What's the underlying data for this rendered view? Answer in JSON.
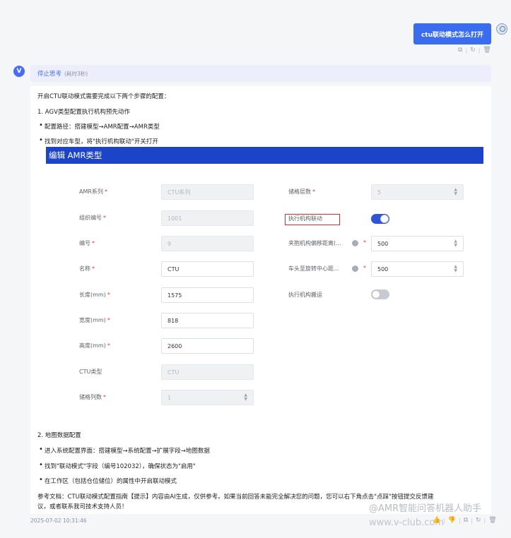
{
  "user_message": {
    "text": "ctu联动模式怎么打开"
  },
  "user_actions": {
    "copy": "⧉",
    "refresh": "↻",
    "delete": "🗑"
  },
  "bot": {
    "avatar_letter": "V"
  },
  "thinking": {
    "label": "停止思考",
    "time": "(耗时3秒)"
  },
  "answer": {
    "intro": "开启CTU联动模式需要完成以下两个步骤的配置：",
    "step1_title": "1. AGV类型配置执行机构预先动作",
    "step1_bullets": [
      "配置路径：搭建模型→AMR配置→AMR类型",
      "找到对应车型，将\"执行机构联动\"开关打开"
    ],
    "step2_title": "2. 地图数据配置",
    "step2_bullets": [
      "进入系统配置界面：搭建模型→系统配置→扩展字段→地图数据",
      "找到\"联动模式\"字段（编号102032），确保状态为\"启用\"",
      "在工作区（包括仓位储位）的属性中开启联动模式"
    ],
    "reference_line1": "参考文档：CTU联动模式配置指南【提示】内容由AI生成，仅供参考。如果当前回答未能完全解决您的问题，您可以右下角点击\"点踩\"按钮提交反馈建",
    "reference_line2": "议，或者联系我司技术支持人员！"
  },
  "form": {
    "title": "编辑 AMR类型",
    "required_mark": "*",
    "left_fields": [
      {
        "label": "AMR系列",
        "required": true,
        "value": "CTU系列",
        "disabled": true
      },
      {
        "label": "组织编号",
        "required": true,
        "value": "1001",
        "disabled": true
      },
      {
        "label": "编号",
        "required": true,
        "value": "9",
        "disabled": true
      },
      {
        "label": "名称",
        "required": true,
        "value": "CTU",
        "disabled": false
      },
      {
        "label": "长度(mm)",
        "required": true,
        "value": "1575",
        "disabled": false
      },
      {
        "label": "宽度(mm)",
        "required": true,
        "value": "818",
        "disabled": false
      },
      {
        "label": "高度(mm)",
        "required": true,
        "value": "2600",
        "disabled": false
      },
      {
        "label": "CTU类型",
        "required": false,
        "value": "CTU",
        "disabled": true
      },
      {
        "label": "储格列数",
        "required": true,
        "value": "1",
        "disabled": true
      }
    ],
    "right_fields": {
      "storage_layers": {
        "label": "储格层数",
        "value": "5"
      },
      "actuator_linkage": {
        "label": "执行机构联动",
        "on": true
      },
      "clamp_offset": {
        "label": "夹抱机构偏移距离(...",
        "value": "500"
      },
      "head_rotation": {
        "label": "车头至旋转中心距...",
        "value": "500"
      },
      "actuator_carry": {
        "label": "执行机构搬运",
        "on": false
      }
    },
    "spinner_glyph": "▲\n▼"
  },
  "footer": {
    "timestamp": "2025-07-02 10:31:46"
  },
  "bot_actions": {
    "like": "👍",
    "dislike": "👎",
    "copy": "⧉",
    "refresh": "↻",
    "delete": "🗑"
  },
  "watermark": {
    "line1": "@AMR智能问答机器人助手",
    "line2": "www.v-club.com"
  }
}
